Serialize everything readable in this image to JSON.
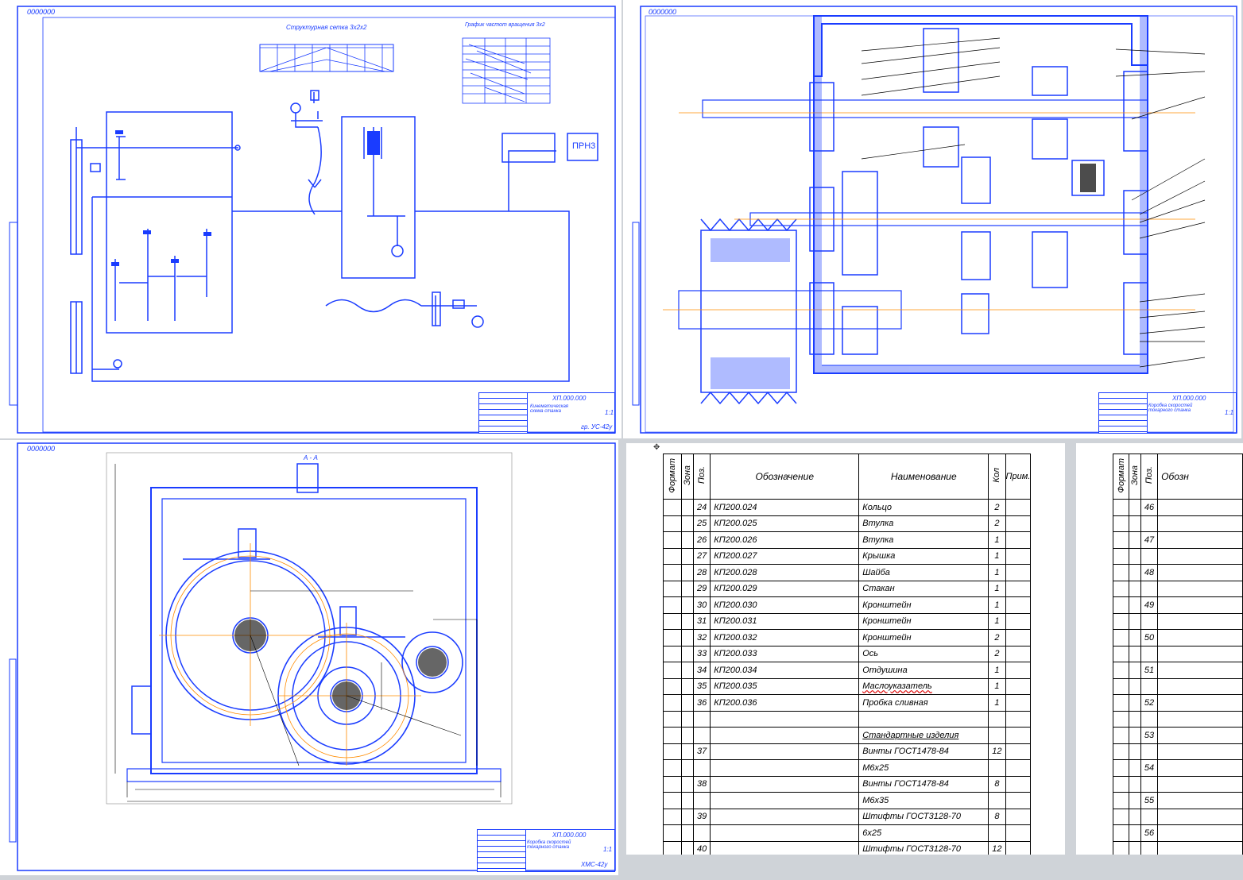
{
  "sheets": {
    "kinematic": {
      "stamp": "0000000",
      "header_structure": "Структурная сетка 3x2x2",
      "header_rpm_graph": "График частот вращения 3x2",
      "motor_label": "ПРН3",
      "tb_code": "ХП.000.000",
      "tb_name": "Кинематическая схема станка",
      "tb_scale": "1:1",
      "tb_group": "гр. УС-42у"
    },
    "section": {
      "stamp": "0000000",
      "tb_code": "ХП.000.000",
      "tb_name": "Коробка скоростей токарного станка",
      "tb_scale": "1:1"
    },
    "view": {
      "stamp": "0000000",
      "view_label": "А - А",
      "tb_code": "ХП.000.000",
      "tb_name": "Коробка скоростей токарного станка",
      "tb_scale": "1:1",
      "tb_group": "ХМС-42у"
    }
  },
  "spec_headers": {
    "format": "Формат",
    "zone": "Зона",
    "pos": "Поз.",
    "designation": "Обозначение",
    "name": "Наименование",
    "qty": "Кол",
    "note": "Прим."
  },
  "spec_rows": [
    {
      "pos": "24",
      "des": "КП200.024",
      "name": "Кольцо",
      "qty": "2"
    },
    {
      "pos": "25",
      "des": "КП200.025",
      "name": "Втулка",
      "qty": "2"
    },
    {
      "pos": "26",
      "des": "КП200.026",
      "name": "Втулка",
      "qty": "1"
    },
    {
      "pos": "27",
      "des": "КП200.027",
      "name": "Крышка",
      "qty": "1"
    },
    {
      "pos": "28",
      "des": "КП200.028",
      "name": "Шайба",
      "qty": "1"
    },
    {
      "pos": "29",
      "des": "КП200.029",
      "name": "Стакан",
      "qty": "1"
    },
    {
      "pos": "30",
      "des": "КП200.030",
      "name": "Кронштейн",
      "qty": "1"
    },
    {
      "pos": "31",
      "des": "КП200.031",
      "name": "Кронштейн",
      "qty": "1"
    },
    {
      "pos": "32",
      "des": "КП200.032",
      "name": "Кронштейн",
      "qty": "2"
    },
    {
      "pos": "33",
      "des": "КП200.033",
      "name": "Ось",
      "qty": "2"
    },
    {
      "pos": "34",
      "des": "КП200.034",
      "name": "Отдушина",
      "qty": "1"
    },
    {
      "pos": "35",
      "des": "КП200.035",
      "name": "Маслоуказатель",
      "qty": "1"
    },
    {
      "pos": "36",
      "des": "КП200.036",
      "name": "Пробка сливная",
      "qty": "1"
    },
    {
      "pos": "",
      "des": "",
      "name": "",
      "qty": ""
    },
    {
      "pos": "",
      "des": "",
      "name": "Стандартные изделия",
      "qty": ""
    },
    {
      "pos": "37",
      "des": "",
      "name": "Винты ГОСТ1478-84",
      "qty": "12"
    },
    {
      "pos": "",
      "des": "",
      "name": "М6х25",
      "qty": ""
    },
    {
      "pos": "38",
      "des": "",
      "name": "Винты ГОСТ1478-84",
      "qty": "8"
    },
    {
      "pos": "",
      "des": "",
      "name": "М6х35",
      "qty": ""
    },
    {
      "pos": "39",
      "des": "",
      "name": "Штифты ГОСТ3128-70",
      "qty": "8"
    },
    {
      "pos": "",
      "des": "",
      "name": "6х25",
      "qty": ""
    },
    {
      "pos": "40",
      "des": "",
      "name": "Штифты ГОСТ3128-70",
      "qty": "12"
    }
  ],
  "spec2_headers": {
    "format": "Формат",
    "zone": "Зона",
    "pos": "Поз.",
    "designation": "Обозн"
  },
  "spec2_rows": [
    "46",
    "47",
    "48",
    "49",
    "50",
    "51",
    "52",
    "53",
    "54",
    "55",
    "56"
  ]
}
